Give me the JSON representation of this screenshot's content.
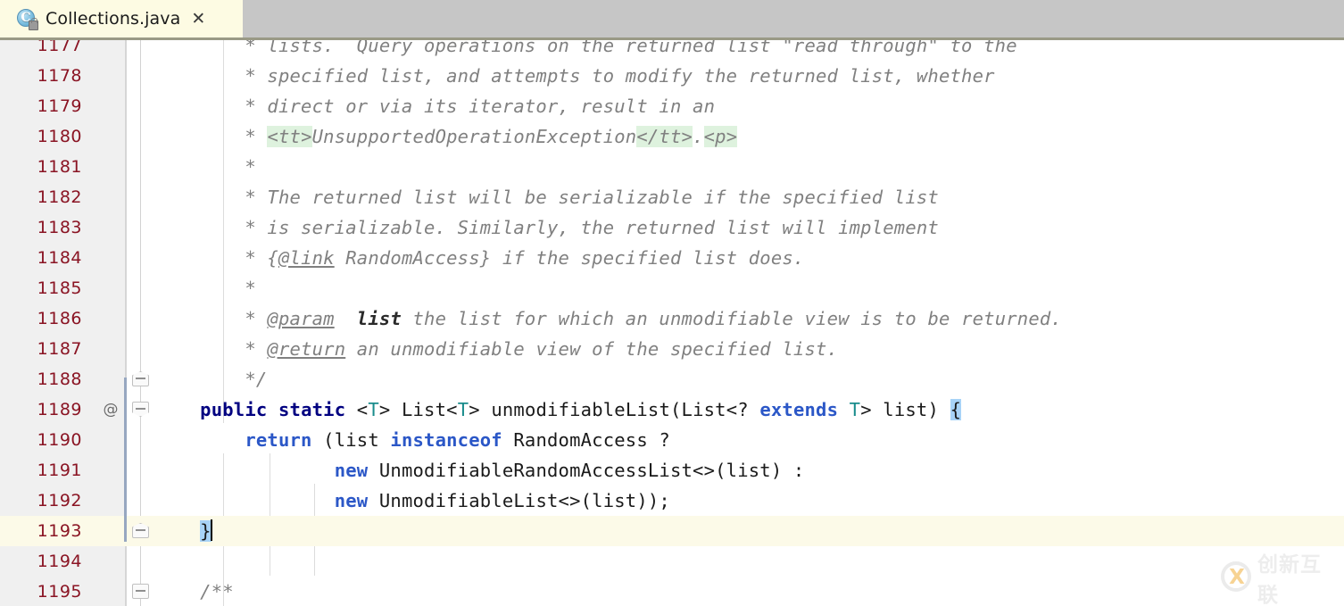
{
  "window": {
    "app": "IntelliJ IDEA editor"
  },
  "tab": {
    "label": "Collections.java",
    "close_label": "✕",
    "icon_letter": "C",
    "icon_name": "java-class-icon",
    "badge_name": "lock-badge-icon"
  },
  "editor": {
    "first_line": 1177,
    "caret_line": 1193,
    "annotation_marker": "@",
    "lines": [
      {
        "no": "1177",
        "annot": "",
        "tokens": [
          {
            "t": "        ",
            "c": "plain"
          },
          {
            "t": "* lists.  Query operations on the returned list \"read through\" to the",
            "c": "cmt"
          }
        ]
      },
      {
        "no": "1178",
        "annot": "",
        "tokens": [
          {
            "t": "        ",
            "c": "plain"
          },
          {
            "t": "* specified list, and attempts to modify the returned list, whether",
            "c": "cmt"
          }
        ]
      },
      {
        "no": "1179",
        "annot": "",
        "tokens": [
          {
            "t": "        ",
            "c": "plain"
          },
          {
            "t": "* direct or via its iterator, result in an",
            "c": "cmt"
          }
        ]
      },
      {
        "no": "1180",
        "annot": "",
        "tokens": [
          {
            "t": "        ",
            "c": "plain"
          },
          {
            "t": "* ",
            "c": "cmt"
          },
          {
            "t": "<tt>",
            "c": "cmt-tag"
          },
          {
            "t": "UnsupportedOperationException",
            "c": "cmt"
          },
          {
            "t": "</tt>",
            "c": "cmt-tag"
          },
          {
            "t": ".",
            "c": "cmt"
          },
          {
            "t": "<p>",
            "c": "cmt-tag"
          }
        ]
      },
      {
        "no": "1181",
        "annot": "",
        "tokens": [
          {
            "t": "        ",
            "c": "plain"
          },
          {
            "t": "*",
            "c": "cmt"
          }
        ]
      },
      {
        "no": "1182",
        "annot": "",
        "tokens": [
          {
            "t": "        ",
            "c": "plain"
          },
          {
            "t": "* The returned list will be serializable if the specified list",
            "c": "cmt"
          }
        ]
      },
      {
        "no": "1183",
        "annot": "",
        "tokens": [
          {
            "t": "        ",
            "c": "plain"
          },
          {
            "t": "* is serializable. Similarly, the returned list will implement",
            "c": "cmt"
          }
        ]
      },
      {
        "no": "1184",
        "annot": "",
        "tokens": [
          {
            "t": "        ",
            "c": "plain"
          },
          {
            "t": "* {",
            "c": "cmt"
          },
          {
            "t": "@link",
            "c": "cmt-link"
          },
          {
            "t": " RandomAccess} if the specified list does.",
            "c": "cmt"
          }
        ]
      },
      {
        "no": "1185",
        "annot": "",
        "tokens": [
          {
            "t": "        ",
            "c": "plain"
          },
          {
            "t": "*",
            "c": "cmt"
          }
        ]
      },
      {
        "no": "1186",
        "annot": "",
        "tokens": [
          {
            "t": "        ",
            "c": "plain"
          },
          {
            "t": "* ",
            "c": "cmt"
          },
          {
            "t": "@param",
            "c": "cmt-link"
          },
          {
            "t": "  ",
            "c": "cmt"
          },
          {
            "t": "list",
            "c": "cmt-param"
          },
          {
            "t": " the list for which an unmodifiable view is to be returned.",
            "c": "cmt"
          }
        ]
      },
      {
        "no": "1187",
        "annot": "",
        "tokens": [
          {
            "t": "        ",
            "c": "plain"
          },
          {
            "t": "* ",
            "c": "cmt"
          },
          {
            "t": "@return",
            "c": "cmt-link"
          },
          {
            "t": " an unmodifiable view of the specified list.",
            "c": "cmt"
          }
        ]
      },
      {
        "no": "1188",
        "annot": "",
        "tokens": [
          {
            "t": "        ",
            "c": "plain"
          },
          {
            "t": "*/",
            "c": "cmt"
          }
        ]
      },
      {
        "no": "1189",
        "annot": "@",
        "tokens": [
          {
            "t": "    ",
            "c": "plain"
          },
          {
            "t": "public",
            "c": "kw"
          },
          {
            "t": " ",
            "c": "plain"
          },
          {
            "t": "static",
            "c": "kw"
          },
          {
            "t": " <",
            "c": "plain"
          },
          {
            "t": "T",
            "c": "tparam"
          },
          {
            "t": "> List<",
            "c": "plain"
          },
          {
            "t": "T",
            "c": "tparam"
          },
          {
            "t": "> unmodifiableList(List<? ",
            "c": "plain"
          },
          {
            "t": "extends",
            "c": "kw2"
          },
          {
            "t": " ",
            "c": "plain"
          },
          {
            "t": "T",
            "c": "tparam"
          },
          {
            "t": "> list) ",
            "c": "plain"
          },
          {
            "t": "{",
            "c": "brace-hl"
          }
        ]
      },
      {
        "no": "1190",
        "annot": "",
        "tokens": [
          {
            "t": "        ",
            "c": "plain"
          },
          {
            "t": "return",
            "c": "kw2"
          },
          {
            "t": " (list ",
            "c": "plain"
          },
          {
            "t": "instanceof",
            "c": "kw2"
          },
          {
            "t": " RandomAccess ?",
            "c": "plain"
          }
        ]
      },
      {
        "no": "1191",
        "annot": "",
        "tokens": [
          {
            "t": "                ",
            "c": "plain"
          },
          {
            "t": "new",
            "c": "kw2"
          },
          {
            "t": " UnmodifiableRandomAccessList<>(list) :",
            "c": "plain"
          }
        ]
      },
      {
        "no": "1192",
        "annot": "",
        "tokens": [
          {
            "t": "                ",
            "c": "plain"
          },
          {
            "t": "new",
            "c": "kw2"
          },
          {
            "t": " UnmodifiableList<>(list));",
            "c": "plain"
          }
        ]
      },
      {
        "no": "1193",
        "annot": "",
        "caret": true,
        "tokens": [
          {
            "t": "    ",
            "c": "plain"
          },
          {
            "t": "}",
            "c": "brace-hl"
          }
        ]
      },
      {
        "no": "1194",
        "annot": "",
        "tokens": []
      },
      {
        "no": "1195",
        "annot": "",
        "tokens": [
          {
            "t": "    ",
            "c": "plain"
          },
          {
            "t": "/**",
            "c": "cmt"
          }
        ]
      }
    ],
    "fold_markers": [
      {
        "line": "1188",
        "shape": "up"
      },
      {
        "line": "1189",
        "shape": "down"
      },
      {
        "line": "1193",
        "shape": "up"
      },
      {
        "line": "1195",
        "shape": "square"
      }
    ]
  },
  "watermark": {
    "text": "创新互联",
    "logo_letter": "X"
  },
  "colors": {
    "tab_strip": "#c6c6c6",
    "tab_active": "#fdfbe3",
    "gutter": "#f0f0f0",
    "lineno": "#8a1423",
    "comment": "#808080",
    "keyword": "#000080",
    "keyword_alt": "#2b57c7",
    "type_param": "#1a8c8c",
    "brace_highlight": "#a8d3f7",
    "caret_line": "#fcfae8",
    "html_tag_bg": "#def2de",
    "change_bar": "#97a7c0",
    "watermark_accent": "#f0a82a"
  }
}
